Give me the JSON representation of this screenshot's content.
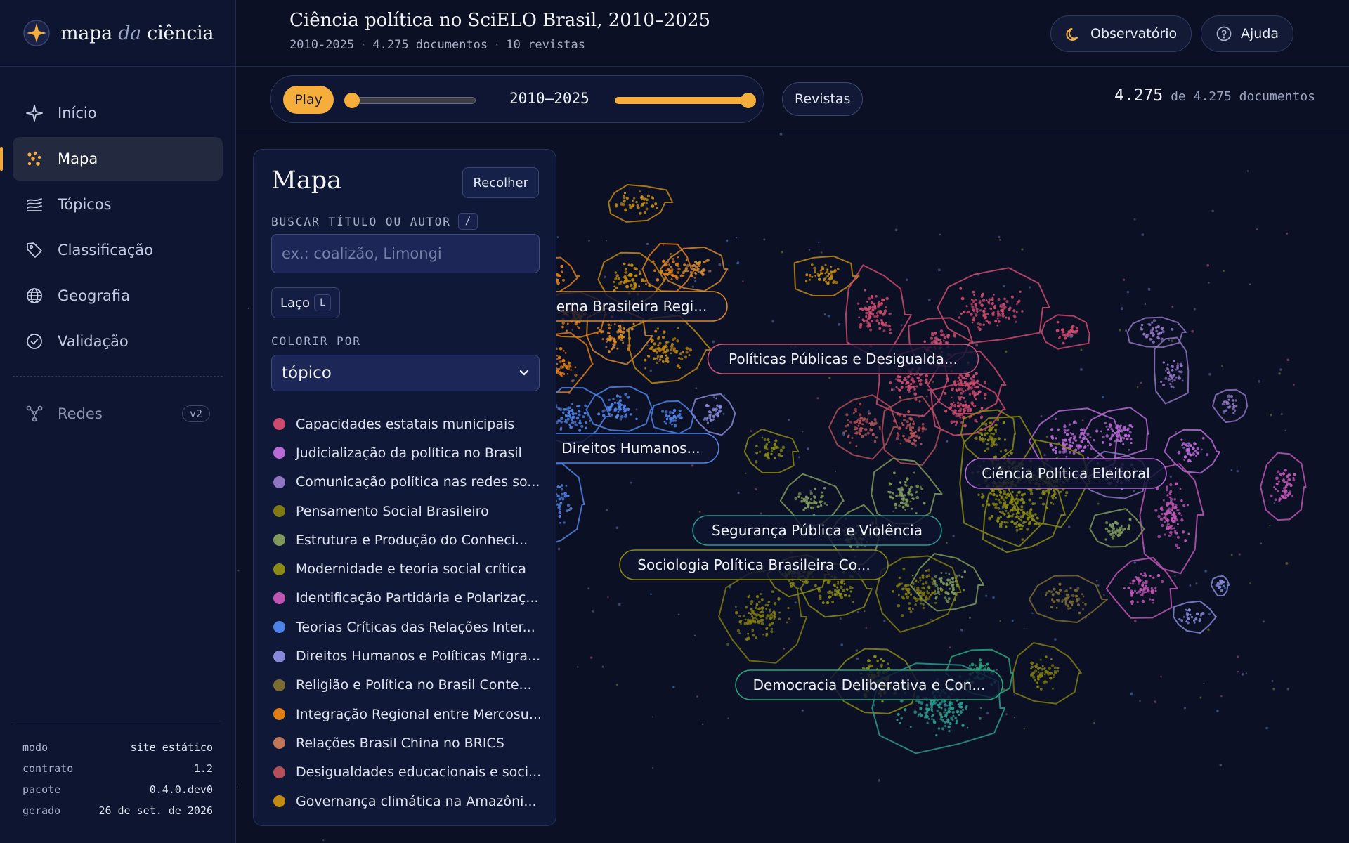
{
  "brand": {
    "prefix": "mapa",
    "mid": "da",
    "suffix": "ciência"
  },
  "nav": [
    {
      "label": "Início",
      "icon": "sparkle-icon"
    },
    {
      "label": "Mapa",
      "icon": "scatter-icon",
      "active": true
    },
    {
      "label": "Tópicos",
      "icon": "layers-icon"
    },
    {
      "label": "Classificação",
      "icon": "tag-icon"
    },
    {
      "label": "Geografia",
      "icon": "globe-icon"
    },
    {
      "label": "Validação",
      "icon": "check-circle-icon"
    }
  ],
  "nav_extra": {
    "label": "Redes",
    "badge": "v2",
    "icon": "network-icon"
  },
  "meta": [
    {
      "k": "modo",
      "v": "site estático"
    },
    {
      "k": "contrato",
      "v": "1.2"
    },
    {
      "k": "pacote",
      "v": "0.4.0.dev0"
    },
    {
      "k": "gerado",
      "v": "26 de set. de 2026"
    }
  ],
  "header": {
    "title": "Ciência política no SciELO Brasil, 2010–2025",
    "sub": [
      "2010-2025",
      "4.275 documentos",
      "10 revistas"
    ],
    "observatorio": "Observatório",
    "ajuda": "Ajuda"
  },
  "toolbar": {
    "play": "Play",
    "range": "2010–2025",
    "revistas": "Revistas",
    "count": "4.275",
    "count_suffix": "de 4.275 documentos"
  },
  "panel": {
    "title": "Mapa",
    "collapse": "Recolher",
    "search_label": "BUSCAR TÍTULO OU AUTOR",
    "search_key": "/",
    "search_placeholder": "ex.: coalizão, Limongi",
    "lasso": "Laço",
    "lasso_key": "L",
    "color_label": "COLORIR POR",
    "color_value": "tópico"
  },
  "legend": [
    {
      "label": "Capacidades estatais municipais",
      "color": "#cc4a6e"
    },
    {
      "label": "Judicialização da política no Brasil",
      "color": "#b86ad6"
    },
    {
      "label": "Comunicação política nas redes so...",
      "color": "#8f75c2"
    },
    {
      "label": "Pensamento Social Brasileiro",
      "color": "#7f7b10"
    },
    {
      "label": "Estrutura e Produção do Conheci...",
      "color": "#7f9a5c"
    },
    {
      "label": "Modernidade e teoria social crítica",
      "color": "#8a8a14"
    },
    {
      "label": "Identificação Partidária e Polarizaç...",
      "color": "#c055b4"
    },
    {
      "label": "Teorias Críticas das Relações Inter...",
      "color": "#4f82e6"
    },
    {
      "label": "Direitos Humanos e Políticas Migra...",
      "color": "#8589d8"
    },
    {
      "label": "Religião e Política no Brasil Conte...",
      "color": "#7b6c34"
    },
    {
      "label": "Integração Regional entre Mercosu...",
      "color": "#e07e16"
    },
    {
      "label": "Relações Brasil China no BRICS",
      "color": "#c0775a"
    },
    {
      "label": "Desigualdades educacionais e soci...",
      "color": "#b24f58"
    },
    {
      "label": "Governança climática na Amazôni...",
      "color": "#c28a10"
    }
  ],
  "map": {
    "labels": [
      {
        "text": "Política Externa Brasileira Regi...",
        "color": "#d9892a"
      },
      {
        "text": "Políticas Públicas e Desigualda...",
        "color": "#c9557a"
      },
      {
        "text": "Segurança e Direitos Humanos...",
        "color": "#4f82e6"
      },
      {
        "text": "Ciência Política Eleitoral",
        "color": "#b86ad6"
      },
      {
        "text": "Segurança Pública e Violência",
        "color": "#2a9a8f"
      },
      {
        "text": "Sociologia Política Brasileira Co...",
        "color": "#8a8a14"
      },
      {
        "text": "Democracia Deliberativa e Con...",
        "color": "#22a87c"
      }
    ]
  }
}
